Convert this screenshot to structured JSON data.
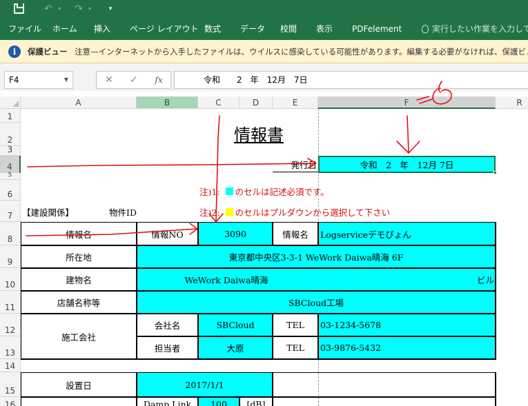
{
  "app": {
    "qat": {
      "save_icon": "save-icon",
      "undo_icon": "undo-icon",
      "redo_icon": "redo-icon",
      "more_icon": "customize-qat-icon"
    },
    "colors": {
      "excel_green": "#217346",
      "cell_cyan": "#00FFFF",
      "annotation_red": "#D01010",
      "message_yellow": "#FFF4CE"
    }
  },
  "ribbon": {
    "tabs": [
      "ファイル",
      "ホーム",
      "挿入",
      "ページ レイアウト",
      "数式",
      "データ",
      "校閲",
      "表示",
      "PDFelement"
    ],
    "tell_me": "実行したい作業を入力してください"
  },
  "message_bar": {
    "title": "保護ビュー",
    "text": "注意—インターネットから入手したファイルは、ウイルスに感染している可能性があります。編集する必要がなければ、保護ビューのままにしておくことをお勧めします。"
  },
  "formula_bar": {
    "name_box": "F4",
    "cancel_glyph": "✕",
    "enter_glyph": "✓",
    "fx_label": "fx",
    "value": "令和　　2　年　12月　7日"
  },
  "columns": [
    "A",
    "B",
    "C",
    "D",
    "E",
    "F",
    "R"
  ],
  "rows": [
    "1",
    "2",
    "3",
    "4",
    "5",
    "6",
    "7",
    "8",
    "9",
    "10",
    "11",
    "12",
    "13",
    "14",
    "15",
    "16"
  ],
  "sheet": {
    "title": "情報書",
    "issue_date_label": "発行日",
    "issue_date_value": "令和　2　年　12月 7日",
    "note1_prefix": "注)1:",
    "note1_text": "のセルは記述必須です。",
    "note2_prefix": "注)2:",
    "note2_text": "のセルはプルダウンから選択して下さい",
    "category": "【建設関係】",
    "property_id": "物件ID",
    "info_name_label": "情報名",
    "info_no_label": "情報NO",
    "info_no_value": "3090",
    "info_name_label2": "情報名",
    "info_name_value": "Logserviceデモぴょん",
    "address_label": "所在地",
    "address_value": "東京都中央区3-3-1 WeWork Daiwa晴海 6F",
    "building_label": "建物名",
    "building_value": "WeWork Daiwa晴海",
    "building_suffix": "ビル",
    "store_label": "店舗名称等",
    "store_value": "SBCloud工場",
    "contractor_label": "施工会社",
    "company_label": "会社名",
    "company_value": "SBCloud",
    "tel_label": "TEL",
    "company_tel": "03-1234-5678",
    "person_label": "担当者",
    "person_value": "大原",
    "person_tel_label": "TEL",
    "person_tel": "03-9876-5432",
    "install_label": "設置日",
    "install_value": "2017/1/1",
    "row16_label": "Damp Link",
    "row16_value": "100",
    "row16_unit": "[dB]"
  },
  "annotations": {
    "hand_drawn_note": "6"
  }
}
